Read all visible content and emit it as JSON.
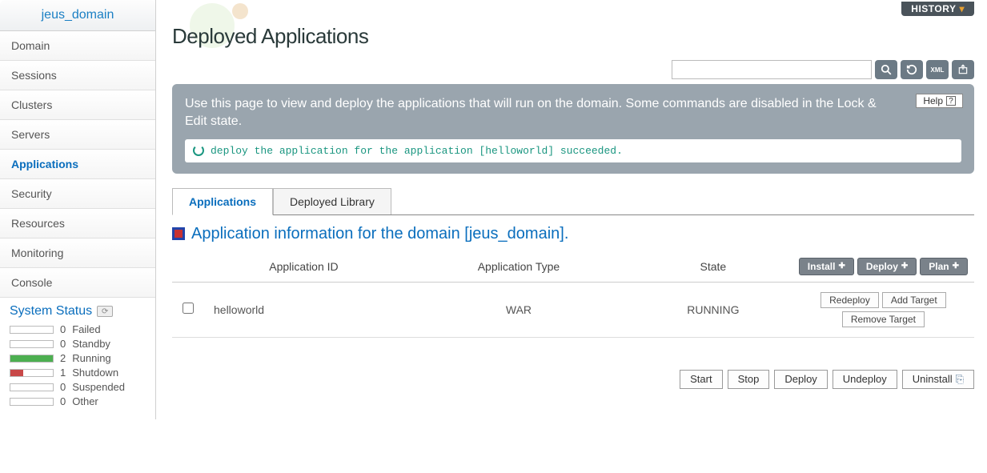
{
  "sidebar": {
    "header": "jeus_domain",
    "items": [
      {
        "label": "Domain"
      },
      {
        "label": "Sessions"
      },
      {
        "label": "Clusters"
      },
      {
        "label": "Servers"
      },
      {
        "label": "Applications",
        "active": true
      },
      {
        "label": "Security"
      },
      {
        "label": "Resources"
      },
      {
        "label": "Monitoring"
      },
      {
        "label": "Console"
      }
    ],
    "system_status": {
      "title": "System Status",
      "rows": [
        {
          "count": "0",
          "label": "Failed",
          "color": "#ffffff",
          "width": "0%"
        },
        {
          "count": "0",
          "label": "Standby",
          "color": "#ffffff",
          "width": "0%"
        },
        {
          "count": "2",
          "label": "Running",
          "color": "#4caf50",
          "width": "100%"
        },
        {
          "count": "1",
          "label": "Shutdown",
          "color": "#c84848",
          "width": "30%"
        },
        {
          "count": "0",
          "label": "Suspended",
          "color": "#ffffff",
          "width": "0%"
        },
        {
          "count": "0",
          "label": "Other",
          "color": "#ffffff",
          "width": "0%"
        }
      ]
    }
  },
  "topbar": {
    "history_label": "HISTORY"
  },
  "page": {
    "title": "Deployed Applications",
    "banner_desc": "Use this page to view and deploy the applications that will run on the domain. Some commands are disabled in the Lock & Edit state.",
    "help_label": "Help",
    "status_message": "deploy the application for the application [helloworld] succeeded."
  },
  "tabs": [
    {
      "label": "Applications",
      "active": true
    },
    {
      "label": "Deployed Library"
    }
  ],
  "section": {
    "title": "Application information for the domain [jeus_domain]."
  },
  "table": {
    "headers": {
      "app_id": "Application ID",
      "app_type": "Application Type",
      "state": "State"
    },
    "header_buttons": {
      "install": "Install",
      "deploy": "Deploy",
      "plan": "Plan"
    },
    "rows": [
      {
        "id": "helloworld",
        "type": "WAR",
        "state": "RUNNING",
        "actions": {
          "redeploy": "Redeploy",
          "add_target": "Add Target",
          "remove_target": "Remove Target"
        }
      }
    ]
  },
  "bottom_actions": {
    "start": "Start",
    "stop": "Stop",
    "deploy": "Deploy",
    "undeploy": "Undeploy",
    "uninstall": "Uninstall"
  }
}
